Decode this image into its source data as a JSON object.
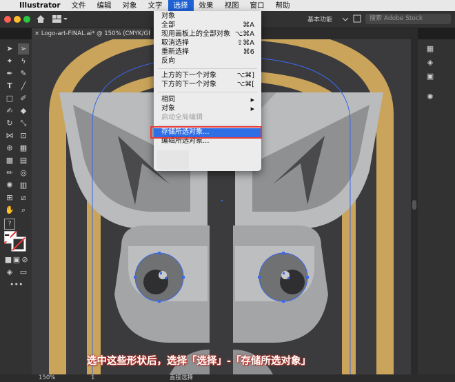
{
  "menubar": {
    "app_name": "Illustrator",
    "items": [
      "文件",
      "编辑",
      "对象",
      "文字",
      "选择",
      "效果",
      "视图",
      "窗口",
      "帮助"
    ],
    "active": "选择"
  },
  "appbar": {
    "workspace": "基本功能",
    "search_placeholder": "搜索 Adobe Stock"
  },
  "document": {
    "tab_title": "Logo-art-FINAL.ai* @ 150% (CMYK/GPU 预览)"
  },
  "select_menu": {
    "items": [
      {
        "label": "对象",
        "shortcut": "",
        "state": "normal"
      },
      {
        "label": "全部",
        "shortcut": "⌘A",
        "state": "normal"
      },
      {
        "label": "现用画板上的全部对象",
        "shortcut": "⌥⌘A",
        "state": "normal"
      },
      {
        "label": "取消选择",
        "shortcut": "⇧⌘A",
        "state": "normal"
      },
      {
        "label": "重新选择",
        "shortcut": "⌘6",
        "state": "normal"
      },
      {
        "label": "反向",
        "shortcut": "",
        "state": "normal"
      },
      {
        "label": "上方的下一个对象",
        "shortcut": "⌥⌘]",
        "state": "normal"
      },
      {
        "label": "下方的下一个对象",
        "shortcut": "⌥⌘[",
        "state": "normal"
      },
      {
        "label": "相同",
        "shortcut": "▶",
        "state": "normal"
      },
      {
        "label": "对象",
        "shortcut": "▶",
        "state": "normal"
      },
      {
        "label": "启动全局编辑",
        "shortcut": "",
        "state": "disabled"
      },
      {
        "label": "存储所选对象...",
        "shortcut": "",
        "state": "highlighted"
      },
      {
        "label": "编辑所选对象...",
        "shortcut": "",
        "state": "normal"
      }
    ]
  },
  "status": {
    "zoom": "150%",
    "artboard": "1",
    "tool": "直接选择"
  },
  "caption": "选中这些形状后，选择「选择」-「存储所选对象」",
  "colors": {
    "gold": "#c9a45a",
    "dark": "#3b3b3d",
    "light_gray": "#b9bbbd",
    "mid_gray": "#8e9092",
    "selection_blue": "#3b67e8",
    "menu_highlight": "#2f6fe6",
    "callout_red": "#e83a3a"
  }
}
